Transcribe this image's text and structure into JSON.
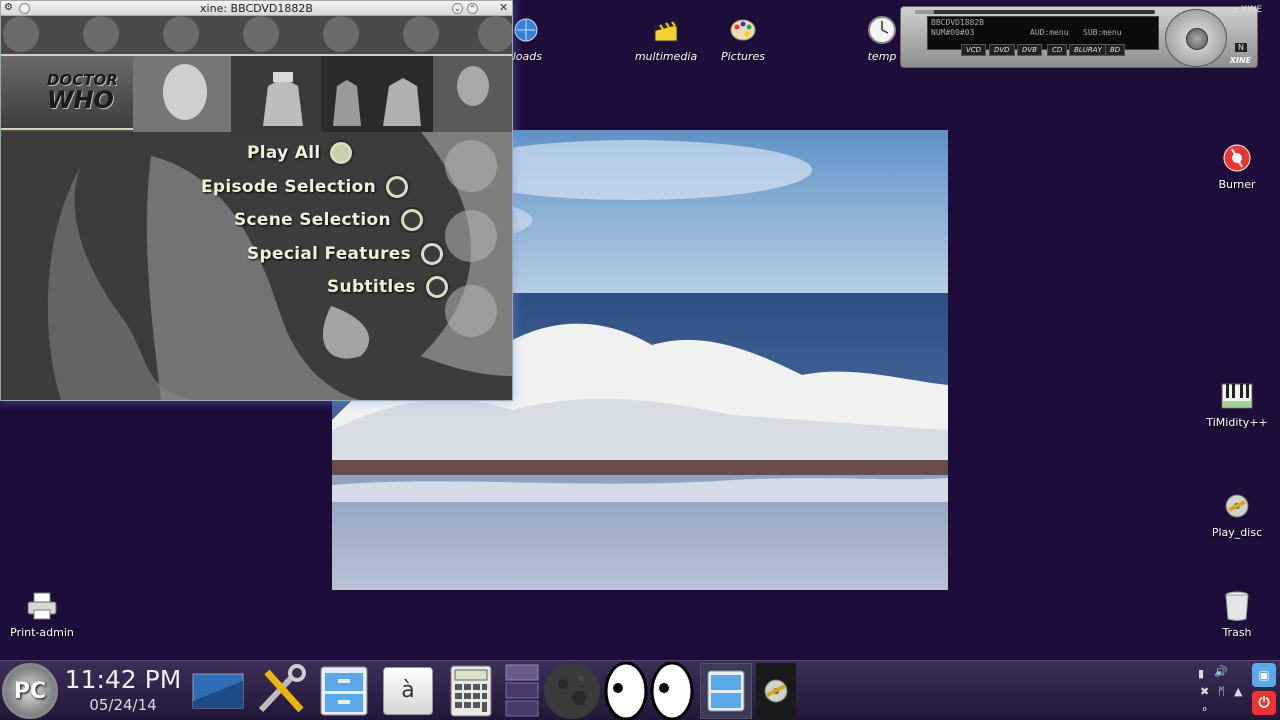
{
  "xine_window": {
    "title": "xine: BBCDVD1882B",
    "dvd_menu": {
      "logo_line1": "DOCTOR",
      "logo_line2": "WHO",
      "items": [
        {
          "label": "Play All"
        },
        {
          "label": "Episode Selection"
        },
        {
          "label": "Scene Selection"
        },
        {
          "label": "Special Features"
        },
        {
          "label": "Subtitles"
        }
      ],
      "selected_index": 0
    }
  },
  "xine_panel": {
    "title_text": "BBCDVD1882B",
    "time_text": "NUM#00#03",
    "aud_text": "AUD:menu",
    "sub_text": "SUB:menu",
    "sources": [
      "VCD",
      "DVD",
      "DVB",
      "CD",
      "BLURAY",
      "BD"
    ],
    "logo": "XINE",
    "corner_text": "XINE",
    "n_button": "N"
  },
  "desktop_icons": [
    {
      "label": "nloads",
      "icon": "globe-icon"
    },
    {
      "label": "multimedia",
      "icon": "clapper-icon"
    },
    {
      "label": "Pictures",
      "icon": "palette-icon"
    },
    {
      "label": "temp",
      "icon": "clock-icon"
    },
    {
      "label": "Burner",
      "icon": "disc-burner-icon"
    },
    {
      "label": "TiMidity++",
      "icon": "piano-icon"
    },
    {
      "label": "Play_disc",
      "icon": "disc-icon"
    },
    {
      "label": "Print-admin",
      "icon": "printer-icon"
    },
    {
      "label": "Trash",
      "icon": "trash-icon"
    }
  ],
  "taskbar": {
    "start_label": "PC",
    "time": "11:42 PM",
    "date": "05/24/14",
    "apps": [
      {
        "name": "desktop-switcher"
      },
      {
        "name": "settings-tools"
      },
      {
        "name": "file-manager"
      },
      {
        "name": "character-map",
        "glyph": "à"
      },
      {
        "name": "calculator"
      },
      {
        "name": "workspace-pager"
      },
      {
        "name": "moon-phase"
      },
      {
        "name": "xeyes"
      },
      {
        "name": "file-cabinet"
      },
      {
        "name": "disc-player"
      }
    ]
  },
  "colors": {
    "desktop_bg": "#1e0d3a",
    "menu_text": "#eef2da"
  }
}
